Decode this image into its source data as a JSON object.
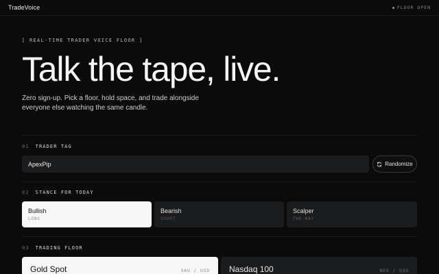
{
  "header": {
    "brand": "TradeVoice",
    "status": "FLOOR OPEN"
  },
  "hero": {
    "eyebrow": "[ REAL-TIME TRADER VOICE FLOOR ]",
    "title": "Talk the tape, live.",
    "lede": "Zero sign-up. Pick a floor, hold space, and trade alongside everyone else watching the same candle."
  },
  "sections": {
    "tag": {
      "num": "01",
      "label": "TRADER TAG",
      "value": "ApexPip",
      "randomize_label": "Randomize"
    },
    "stance": {
      "num": "02",
      "label": "STANCE FOR TODAY",
      "options": [
        {
          "title": "Bullish",
          "sub": "LONG"
        },
        {
          "title": "Bearish",
          "sub": "SHORT"
        },
        {
          "title": "Scalper",
          "sub": "TWO-WAY"
        }
      ],
      "selected": "Bullish"
    },
    "floor": {
      "num": "03",
      "label": "TRADING FLOOR",
      "options": [
        {
          "name": "Gold Spot",
          "pair": "XAU / USD"
        },
        {
          "name": "Nasdaq 100",
          "pair": "NDX / QQQ"
        }
      ],
      "selected": "Gold Spot"
    }
  }
}
